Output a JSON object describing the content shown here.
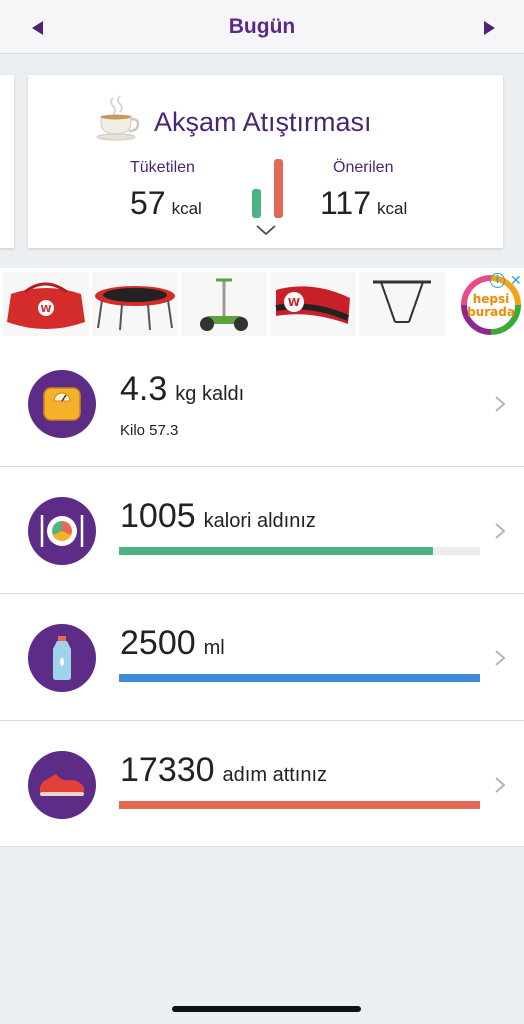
{
  "header": {
    "title": "Bugün",
    "prev_icon": "caret-left-icon",
    "next_icon": "caret-right-icon"
  },
  "meal_card": {
    "title": "Akşam Atıştırması",
    "icon": "tea-cup-icon",
    "consumed_label": "Tüketilen",
    "consumed_value": "57",
    "consumed_unit": "kcal",
    "recommended_label": "Önerilen",
    "recommended_value": "117",
    "recommended_unit": "kcal",
    "colors": {
      "consumed": "#4db383",
      "recommended": "#e26a55"
    }
  },
  "ad": {
    "items": [
      "tennis-bag",
      "trampoline",
      "scooter",
      "racket-bag",
      "pull-up-bar"
    ],
    "brand_line1": "hepsi",
    "brand_line2": "burada"
  },
  "metrics": [
    {
      "icon": "scale-icon",
      "value": "4.3",
      "unit": "kg kaldı",
      "sub": "Kilo 57.3"
    },
    {
      "icon": "plate-icon",
      "value": "1005",
      "unit": "kalori aldınız",
      "progress": 0.87,
      "color": "#4db383"
    },
    {
      "icon": "water-bottle-icon",
      "value": "2500",
      "unit": "ml",
      "progress": 1.0,
      "color": "#3d8bd0"
    },
    {
      "icon": "sneaker-icon",
      "value": "17330",
      "unit": "adım attınız",
      "progress": 1.0,
      "color": "#e26a55"
    }
  ]
}
